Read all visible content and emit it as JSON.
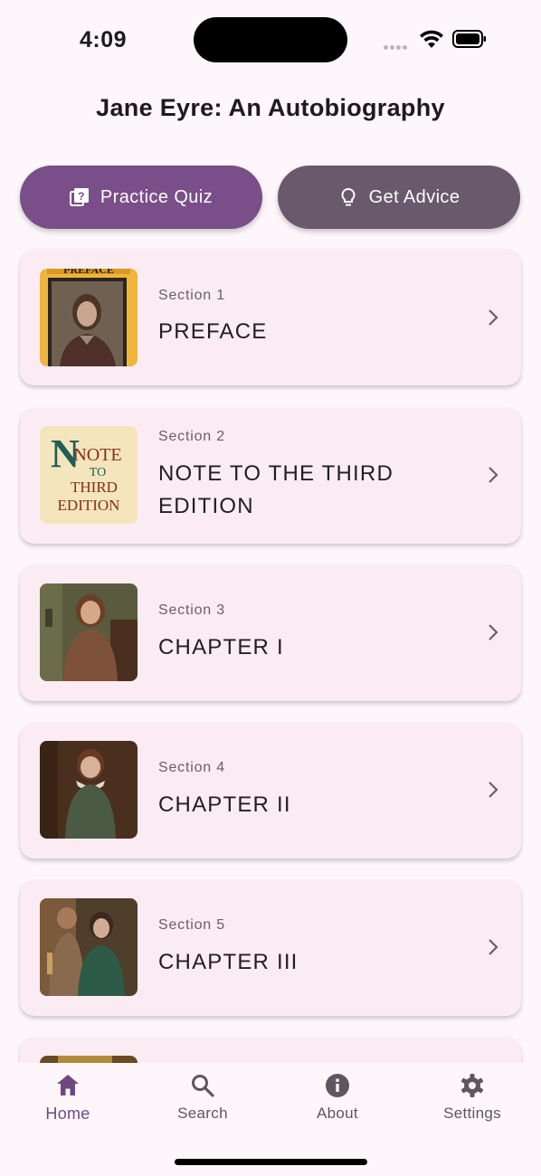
{
  "status": {
    "time": "4:09"
  },
  "header": {
    "title": "Jane Eyre: An Autobiography"
  },
  "actions": {
    "quiz_label": "Practice Quiz",
    "advice_label": "Get Advice"
  },
  "sections": [
    {
      "label": "Section 1",
      "title": "PREFACE",
      "thumb_text": "PREFACE"
    },
    {
      "label": "Section 2",
      "title": "NOTE TO THE THIRD EDITION",
      "thumb_text_1": "NOTE",
      "thumb_text_2": "TO",
      "thumb_text_3": "THIRD",
      "thumb_text_4": "EDITION"
    },
    {
      "label": "Section 3",
      "title": "CHAPTER I"
    },
    {
      "label": "Section 4",
      "title": "CHAPTER II"
    },
    {
      "label": "Section 5",
      "title": "CHAPTER III"
    }
  ],
  "nav": [
    {
      "label": "Home",
      "icon": "home-icon",
      "active": true
    },
    {
      "label": "Search",
      "icon": "search-icon"
    },
    {
      "label": "About",
      "icon": "info-icon"
    },
    {
      "label": "Settings",
      "icon": "gear-icon"
    }
  ],
  "colors": {
    "accent": "#7a4e89",
    "secondary": "#6a586d",
    "card": "#fbecf4",
    "background": "#fdf7fb"
  }
}
